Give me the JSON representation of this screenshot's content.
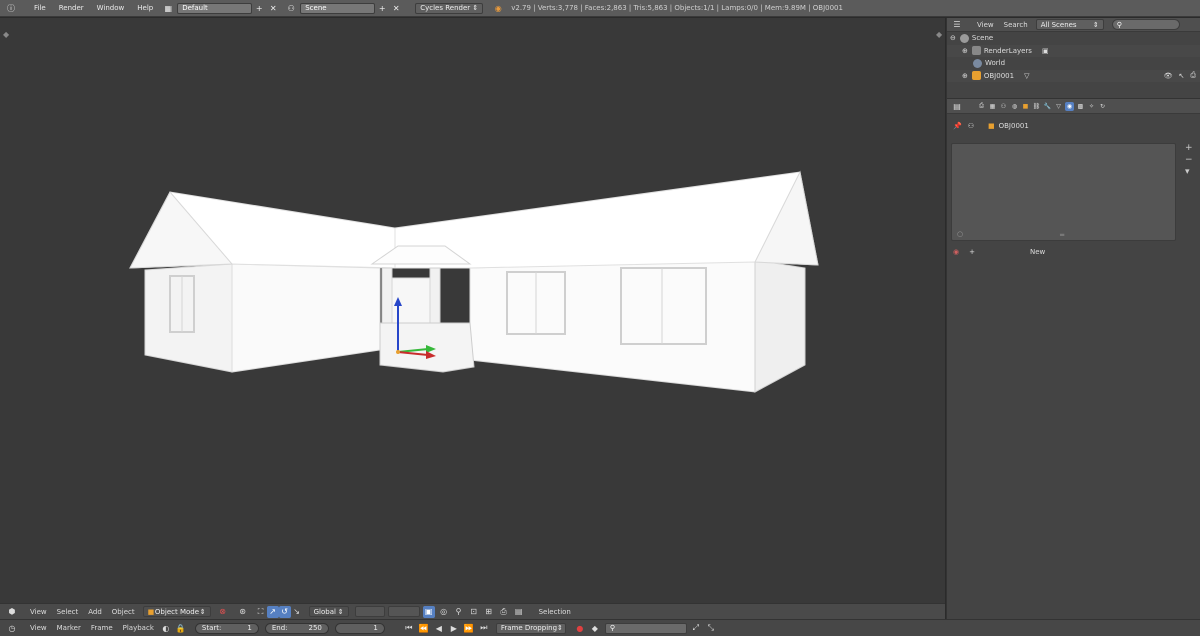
{
  "top_menu": {
    "file": "File",
    "render": "Render",
    "window": "Window",
    "help": "Help",
    "screen_layout": "Default",
    "scene": "Scene",
    "engine": "Cycles Render",
    "stats": "v2.79 | Verts:3,778 | Faces:2,863 | Tris:5,863 | Objects:1/1 | Lamps:0/0 | Mem:9.89M | OBJ0001"
  },
  "outliner": {
    "view": "View",
    "search": "Search",
    "display_mode": "All Scenes",
    "rows": [
      {
        "label": "Scene"
      },
      {
        "label": "RenderLayers"
      },
      {
        "label": "World"
      },
      {
        "label": "OBJ0001"
      }
    ]
  },
  "properties": {
    "object_name": "OBJ0001",
    "new_button": "New"
  },
  "viewport_header": {
    "view": "View",
    "select": "Select",
    "add": "Add",
    "object": "Object",
    "mode": "Object Mode",
    "orientation": "Global",
    "status": "Selection"
  },
  "timeline": {
    "view": "View",
    "marker": "Marker",
    "frame": "Frame",
    "playback": "Playback",
    "start_label": "Start:",
    "start_value": "1",
    "end_label": "End:",
    "end_value": "250",
    "current_frame": "1",
    "sync_mode": "Frame Dropping"
  },
  "colors": {
    "accent_active": "#5680c2",
    "viewport_bg": "#393939",
    "panel_bg": "#444444"
  }
}
